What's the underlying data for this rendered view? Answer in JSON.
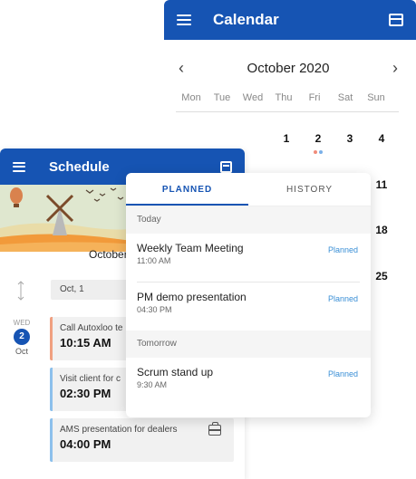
{
  "calendar": {
    "title": "Calendar",
    "month": "October 2020",
    "prev_icon": "chevron-left-icon",
    "next_icon": "chevron-right-icon",
    "weekdays": [
      "Mon",
      "Tue",
      "Wed",
      "Thu",
      "Fri",
      "Sat",
      "Sun"
    ],
    "days": [
      "1",
      "2",
      "3",
      "4",
      "11",
      "18",
      "25"
    ],
    "event_dot_colors": [
      "#f08c7a",
      "#7ab0e8"
    ]
  },
  "schedule": {
    "title": "Schedule",
    "month_heading": "October",
    "date_filter": "Oct, 1",
    "day": {
      "weekday": "WED",
      "date": "2",
      "month": "Oct"
    },
    "events": [
      {
        "name": "Call Autoxloo te",
        "time": "10:15 AM",
        "color": "#f0a080"
      },
      {
        "name": "Visit client for c",
        "time": "02:30 PM",
        "color": "#8cc0ec"
      },
      {
        "name": "AMS presentation for dealers",
        "time": "04:00 PM",
        "color": "#8cc0ec"
      }
    ]
  },
  "panel": {
    "tabs": [
      "PLANNED",
      "HISTORY"
    ],
    "sections": [
      {
        "title": "Today",
        "items": [
          {
            "name": "Weekly Team Meeting",
            "time": "11:00 AM",
            "status": "Planned"
          },
          {
            "name": "PM demo presentation",
            "time": "04:30 PM",
            "status": "Planned"
          }
        ]
      },
      {
        "title": "Tomorrow",
        "items": [
          {
            "name": "Scrum stand up",
            "time": "9:30 AM",
            "status": "Planned"
          }
        ]
      }
    ]
  },
  "colors": {
    "primary": "#1654b3",
    "status": "#3a8fd6"
  }
}
